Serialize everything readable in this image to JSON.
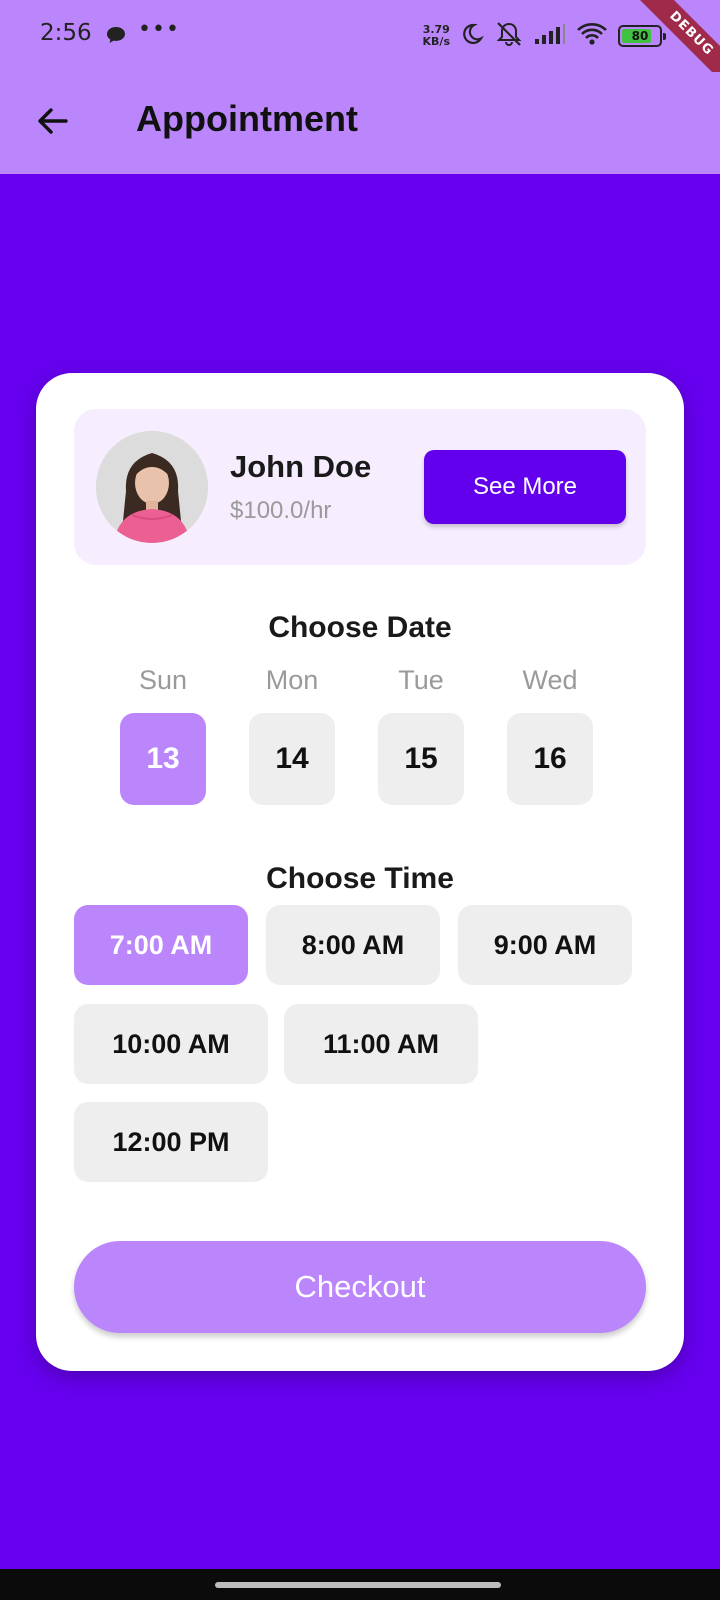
{
  "status_bar": {
    "time": "2:56",
    "net_speed_value": "3.79",
    "net_speed_unit": "KB/s",
    "battery_level": 80,
    "battery_text": "80",
    "debug_label": "DEBUG"
  },
  "app_bar": {
    "title": "Appointment",
    "back_icon": "arrow-left-icon"
  },
  "doctor": {
    "name": "John Doe",
    "rate": "$100.0/hr",
    "see_more_label": "See More"
  },
  "date_section": {
    "title": "Choose Date",
    "dates": [
      {
        "day": "Sun",
        "date": "13",
        "selected": true
      },
      {
        "day": "Mon",
        "date": "14",
        "selected": false
      },
      {
        "day": "Tue",
        "date": "15",
        "selected": false
      },
      {
        "day": "Wed",
        "date": "16",
        "selected": false
      }
    ]
  },
  "time_section": {
    "title": "Choose Time",
    "slots": [
      {
        "label": "7:00 AM",
        "selected": true
      },
      {
        "label": "8:00 AM",
        "selected": false
      },
      {
        "label": "9:00 AM",
        "selected": false
      },
      {
        "label": "10:00 AM",
        "selected": false
      },
      {
        "label": "11:00 AM",
        "selected": false
      },
      {
        "label": "12:00 PM",
        "selected": false
      }
    ]
  },
  "checkout_label": "Checkout",
  "colors": {
    "primary": "#6200EE",
    "accent": "#BB86FC",
    "background": "#6600EE",
    "chip": "#EEEEEE"
  }
}
